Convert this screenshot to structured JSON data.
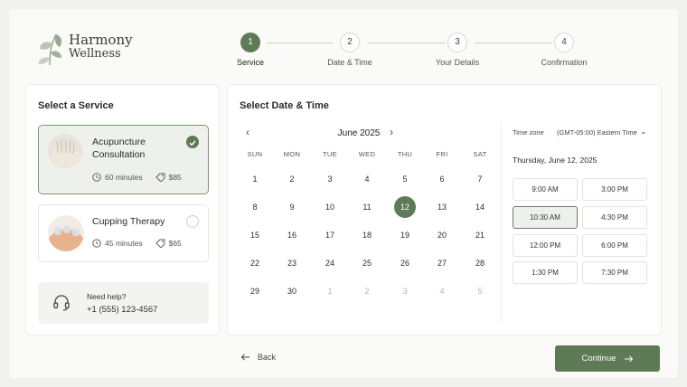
{
  "brand": {
    "line1": "Harmony",
    "line2": "Wellness",
    "accent": "#5f7a57"
  },
  "steps": [
    {
      "num": "1",
      "label": "Service",
      "active": true
    },
    {
      "num": "2",
      "label": "Date & Time",
      "active": false
    },
    {
      "num": "3",
      "label": "Your Details",
      "active": false
    },
    {
      "num": "4",
      "label": "Confirmation",
      "active": false
    }
  ],
  "services": {
    "title": "Select a Service",
    "items": [
      {
        "name_line1": "Acupuncture",
        "name_line2": "Consultation",
        "duration": "60 minutes",
        "price": "$85",
        "selected": true
      },
      {
        "name_line1": "Cupping Therapy",
        "name_line2": "",
        "duration": "45 minutes",
        "price": "$65",
        "selected": false
      }
    ],
    "help": {
      "title": "Need help?",
      "phone": "+1 (555) 123-4567"
    }
  },
  "calendar": {
    "title": "Select Date & Time",
    "month": "June 2025",
    "weekdays": [
      "SUN",
      "MON",
      "TUE",
      "WED",
      "THU",
      "FRI",
      "SAT"
    ],
    "weeks": [
      [
        "1",
        "2",
        "3",
        "4",
        "5",
        "6",
        "7"
      ],
      [
        "8",
        "9",
        "10",
        "11",
        "12",
        "13",
        "14"
      ],
      [
        "15",
        "16",
        "17",
        "18",
        "19",
        "20",
        "21"
      ],
      [
        "22",
        "23",
        "24",
        "25",
        "26",
        "27",
        "28"
      ],
      [
        "29",
        "30",
        "1",
        "2",
        "3",
        "4",
        "5"
      ]
    ],
    "selected_day": "12"
  },
  "times": {
    "timezone_label": "Time zone",
    "timezone_value": "(GMT-05:00) Eastern Time",
    "selected_date": "Thursday, June 12, 2025",
    "slots": [
      [
        "9:00 AM",
        "3:00 PM"
      ],
      [
        "10:30 AM",
        "4:30 PM"
      ],
      [
        "12:00 PM",
        "6:00 PM"
      ],
      [
        "1:30 PM",
        "7:30 PM"
      ]
    ],
    "selected_slot": "10:30 AM"
  },
  "footer": {
    "back_label": "Back",
    "continue_label": "Continue"
  }
}
